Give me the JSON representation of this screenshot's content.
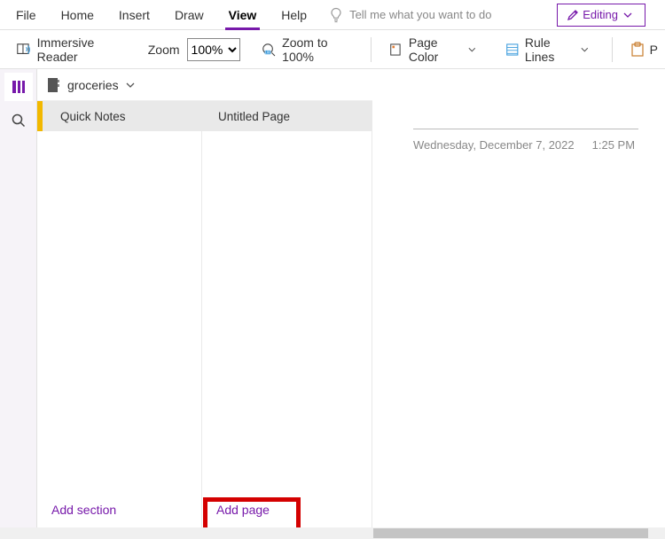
{
  "menu": {
    "tabs": [
      "File",
      "Home",
      "Insert",
      "Draw",
      "View",
      "Help"
    ],
    "active_index": 4,
    "tell_me_placeholder": "Tell me what you want to do",
    "editing_label": "Editing"
  },
  "ribbon": {
    "immersive_reader": "Immersive Reader",
    "zoom_label": "Zoom",
    "zoom_value": "100%",
    "zoom_100": "Zoom to 100%",
    "page_color": "Page Color",
    "rule_lines": "Rule Lines",
    "paste_cut": "P"
  },
  "notebook": {
    "name": "groceries"
  },
  "sections": {
    "items": [
      "Quick Notes"
    ],
    "add_label": "Add section"
  },
  "pages": {
    "items": [
      "Untitled Page"
    ],
    "add_label": "Add page"
  },
  "page": {
    "date": "Wednesday, December 7, 2022",
    "time": "1:25 PM"
  },
  "colors": {
    "accent": "#7719aa",
    "section_tab": "#f2b800",
    "highlight": "#d40000"
  }
}
